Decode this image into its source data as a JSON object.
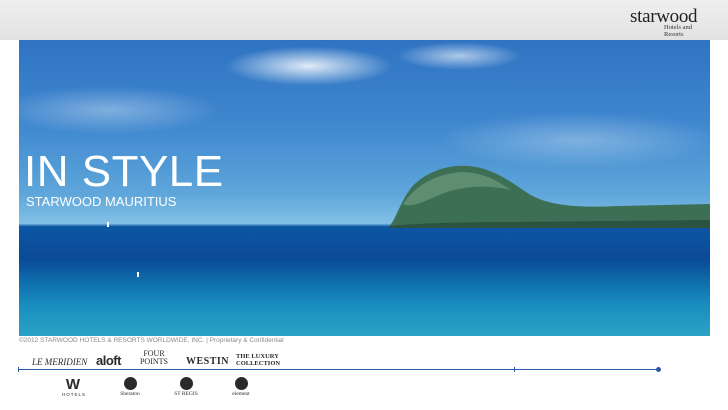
{
  "logo": {
    "wordmark": "starwood",
    "line1": "Hotels and",
    "line2": "Resorts"
  },
  "hero": {
    "title": "IN STYLE",
    "subtitle": "STARWOOD MAURITIUS"
  },
  "footer": {
    "copyright": "©2012 STARWOOD HOTELS & RESORTS WORLDWIDE, INC. | Proprietary & Confidential"
  },
  "brands": {
    "meridien": "LE MERIDIEN",
    "aloft": "aloft",
    "fourpoints_1": "FOUR",
    "fourpoints_2": "POINTS",
    "westin": "WESTIN",
    "luxury_1": "THE LUXURY",
    "luxury_2": "COLLECTION",
    "w_mark": "W",
    "w_sub": "HOTELS",
    "sheraton": "Sheraton",
    "stregis": "ST REGIS",
    "element": "element"
  },
  "colors": {
    "rule": "#2b5aa6",
    "sea": "#0a4a97",
    "sky": "#3f87cf"
  }
}
